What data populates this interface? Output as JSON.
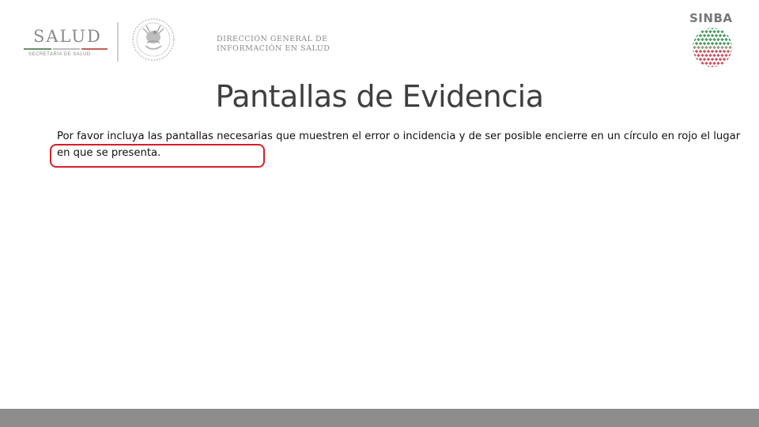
{
  "header": {
    "salud_logo": {
      "word": "SALUD",
      "subtitle": "SECRETARÍA DE SALUD"
    },
    "dgis": {
      "line1": "DIRECCIÓN GENERAL DE",
      "line2": "INFORMACIÓN EN SALUD"
    },
    "sinba": {
      "word": "SINBA"
    },
    "seal_icon": "mexican-coat-of-arms-seal"
  },
  "slide": {
    "title": "Pantallas de Evidencia",
    "instructions": "Por favor incluya las pantallas necesarias que muestren el error o incidencia y de ser posible encierre en un círculo en rojo el lugar en que se presenta."
  },
  "colors": {
    "highlight_circle": "#d42027",
    "footer_bar": "#8c8c8c",
    "title_text": "#3f3f3f"
  }
}
